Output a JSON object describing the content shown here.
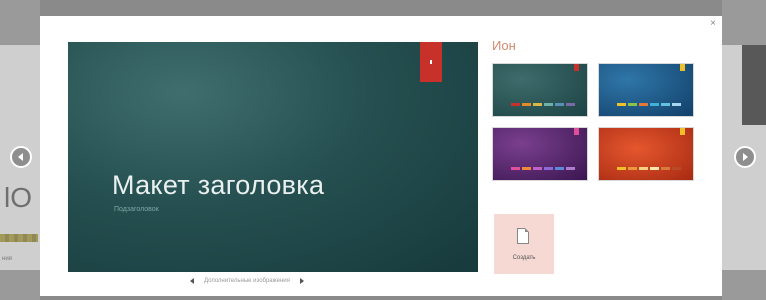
{
  "dialog": {
    "close_symbol": "×",
    "theme_name": "Ион",
    "preview": {
      "title": "Макет заголовка",
      "subtitle": "Подзаголовок",
      "accent_color": "#c8302a"
    },
    "pager_label": "Дополнительные изображения",
    "create_label": "Создать",
    "variants": [
      {
        "name": "variant-teal",
        "bg": "radial-gradient(ellipse at 30% 30%, #3e6c6b, #1c4244)",
        "tab": "#c8302a",
        "swatches": [
          "#c8302a",
          "#e08a2a",
          "#d6b84a",
          "#6fb0a8",
          "#5a8fb6",
          "#7a6aa8"
        ]
      },
      {
        "name": "variant-blue",
        "bg": "radial-gradient(ellipse at 30% 30%, #2f76a8, #12406a)",
        "tab": "#f0c02a",
        "swatches": [
          "#f0c02a",
          "#8bc34a",
          "#e07a3a",
          "#3fb0d8",
          "#62c0e0",
          "#a8d8f0"
        ]
      },
      {
        "name": "variant-purple",
        "bg": "radial-gradient(ellipse at 30% 30%, #7a3f8e, #3a1650)",
        "tab": "#e0509a",
        "swatches": [
          "#e0509a",
          "#f08a3a",
          "#c060c8",
          "#8a6ad8",
          "#5a8ad8",
          "#b07ad0"
        ]
      },
      {
        "name": "variant-orange",
        "bg": "radial-gradient(ellipse at 40% 40%, #e4572e, #a82a12)",
        "tab": "#f0c02a",
        "swatches": [
          "#f0c02a",
          "#e89a3a",
          "#f5d080",
          "#fbe6b0",
          "#d87a3a",
          "#b84a2a"
        ]
      }
    ]
  },
  "backdrop": {
    "left_big_text": "lO",
    "left_small_text": "ния"
  },
  "nav": {
    "prev_icon": "chevron-left-icon",
    "next_icon": "chevron-right-icon"
  }
}
